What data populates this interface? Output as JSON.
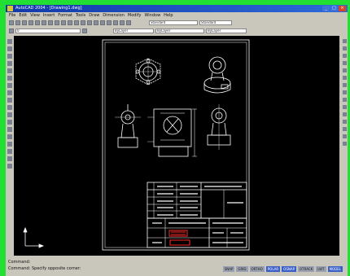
{
  "window": {
    "title": "AutoCAD 2004 - [Drawing1.dwg]",
    "controls": [
      "_",
      "□",
      "×"
    ]
  },
  "menu": {
    "items": [
      "File",
      "Edit",
      "View",
      "Insert",
      "Format",
      "Tools",
      "Draw",
      "Dimension",
      "Modify",
      "Window",
      "Help"
    ]
  },
  "toolbar": {
    "layer_value": "0",
    "style_value": "Standard",
    "color_value": "ByLayer",
    "linetype_value": "ByLayer",
    "lineweight_value": "ByLayer"
  },
  "drawing": {
    "line_color": "#ffffff",
    "accent_color": "#ff2a2a",
    "background_color": "#000000"
  },
  "command": {
    "line1": "Command:",
    "line2": "Command:  Specify opposite corner:"
  },
  "status": {
    "buttons": [
      "SNAP",
      "GRID",
      "ORTHO",
      "POLAR",
      "OSNAP",
      "OTRACK",
      "LWT",
      "MODEL"
    ]
  }
}
